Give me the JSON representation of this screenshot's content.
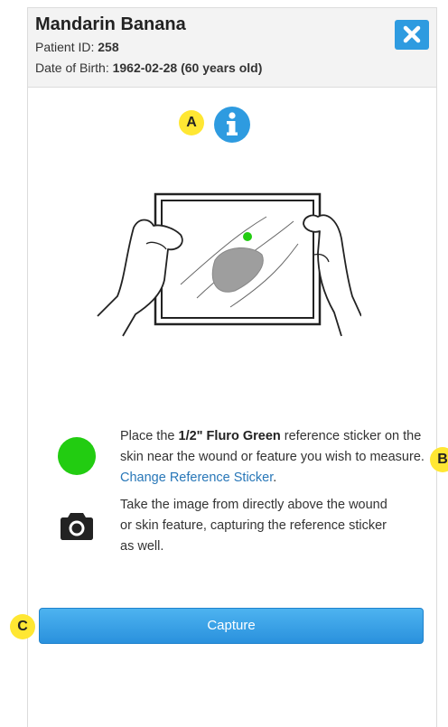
{
  "header": {
    "patient_name": "Mandarin Banana",
    "patient_id_label": "Patient ID:",
    "patient_id": "258",
    "dob_label": "Date of Birth:",
    "dob_value": "1962-02-28 (60 years old)"
  },
  "markers": {
    "a": "A",
    "b": "B",
    "c": "C"
  },
  "instructions": {
    "step1_prefix": "Place the ",
    "step1_sticker": "1/2\" Fluro Green",
    "step1_mid": " reference sticker on the skin near the wound or feature you wish to measure. ",
    "step1_link": "Change Reference Sticker",
    "step1_suffix": ".",
    "step2": "Take the image from directly above the wound or skin feature, capturing the reference sticker as well."
  },
  "capture_button": "Capture",
  "colors": {
    "accent": "#2e9be0",
    "sticker": "#22cc11",
    "marker": "#ffe733",
    "link": "#2877b8"
  },
  "icons": [
    "close-icon",
    "info-icon",
    "camera-icon"
  ]
}
